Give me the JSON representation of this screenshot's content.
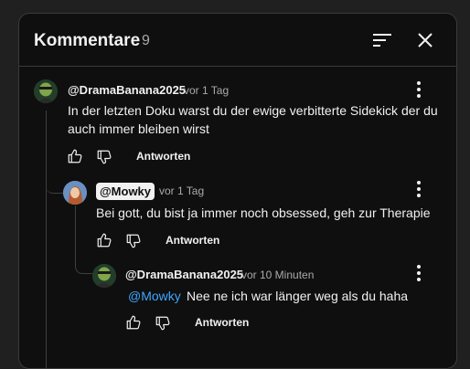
{
  "header": {
    "title": "Kommentare",
    "count": "9"
  },
  "comments": [
    {
      "author": "@DramaBanana2025",
      "time": "vor 1 Tag",
      "text_lines": [
        "In der letzten Doku warst du der ewige verbitterte Sidekick der du",
        "auch immer bleiben wirst"
      ],
      "reply_label": "Antworten"
    },
    {
      "author": "@Mowky",
      "time": "vor 1 Tag",
      "text_lines": [
        "Bei gott, du bist ja immer noch obsessed, geh zur Therapie"
      ],
      "reply_label": "Antworten"
    },
    {
      "author": "@DramaBanana2025",
      "time": "vor 10 Minuten",
      "mention": "@Mowky",
      "text": "Nee ne ich war länger weg als du haha",
      "reply_label": "Antworten"
    }
  ],
  "colors": {
    "background": "#0f0f0f",
    "mention": "#3ea6ff",
    "chip_bg": "#f1f1f1"
  }
}
